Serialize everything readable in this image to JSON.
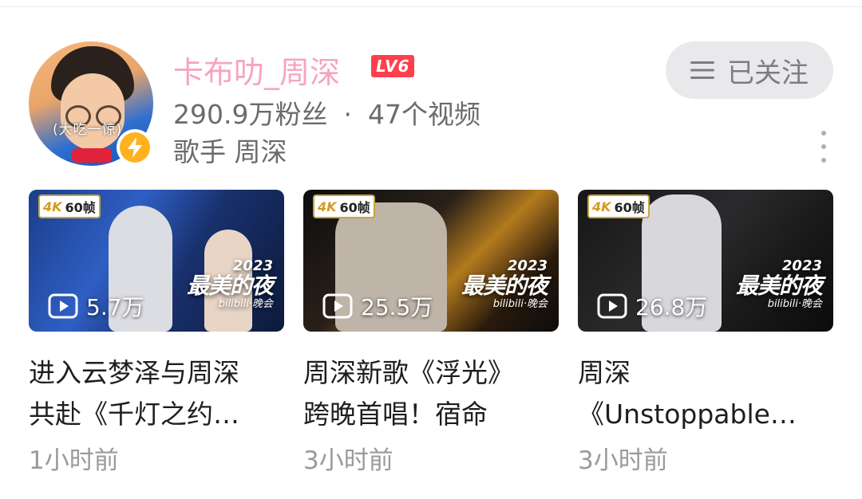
{
  "channel": {
    "name": "卡布叻_周深",
    "level": "LV6",
    "fans": "290.9万粉丝",
    "separator": "·",
    "videos": "47个视频",
    "description": "歌手 周深",
    "avatar_text": "(大吃一惊)",
    "follow_label": "已关注",
    "colors": {
      "name": "#f7a4bf",
      "level_badge": "#ff3f4e",
      "verify_badge": "#ffb21e"
    }
  },
  "videos": [
    {
      "quality": "4K",
      "fps": "60帧",
      "plays": "5.7万",
      "gala_year": "2023",
      "gala_title": "最美的夜",
      "gala_brand": "bilibili·晚会",
      "title_line1": "进入云梦泽与周深",
      "title_line2": "共赴《千灯之约…",
      "time": "1小时前"
    },
    {
      "quality": "4K",
      "fps": "60帧",
      "plays": "25.5万",
      "gala_year": "2023",
      "gala_title": "最美的夜",
      "gala_brand": "bilibili·晚会",
      "title_line1": "周深新歌《浮光》",
      "title_line2": "跨晚首唱！宿命",
      "time": "3小时前"
    },
    {
      "quality": "4K",
      "fps": "60帧",
      "plays": "26.8万",
      "gala_year": "2023",
      "gala_title": "最美的夜",
      "gala_brand": "bilibili·晚会",
      "title_line1": "周深",
      "title_line2": "《Unstoppable…",
      "time": "3小时前"
    }
  ]
}
